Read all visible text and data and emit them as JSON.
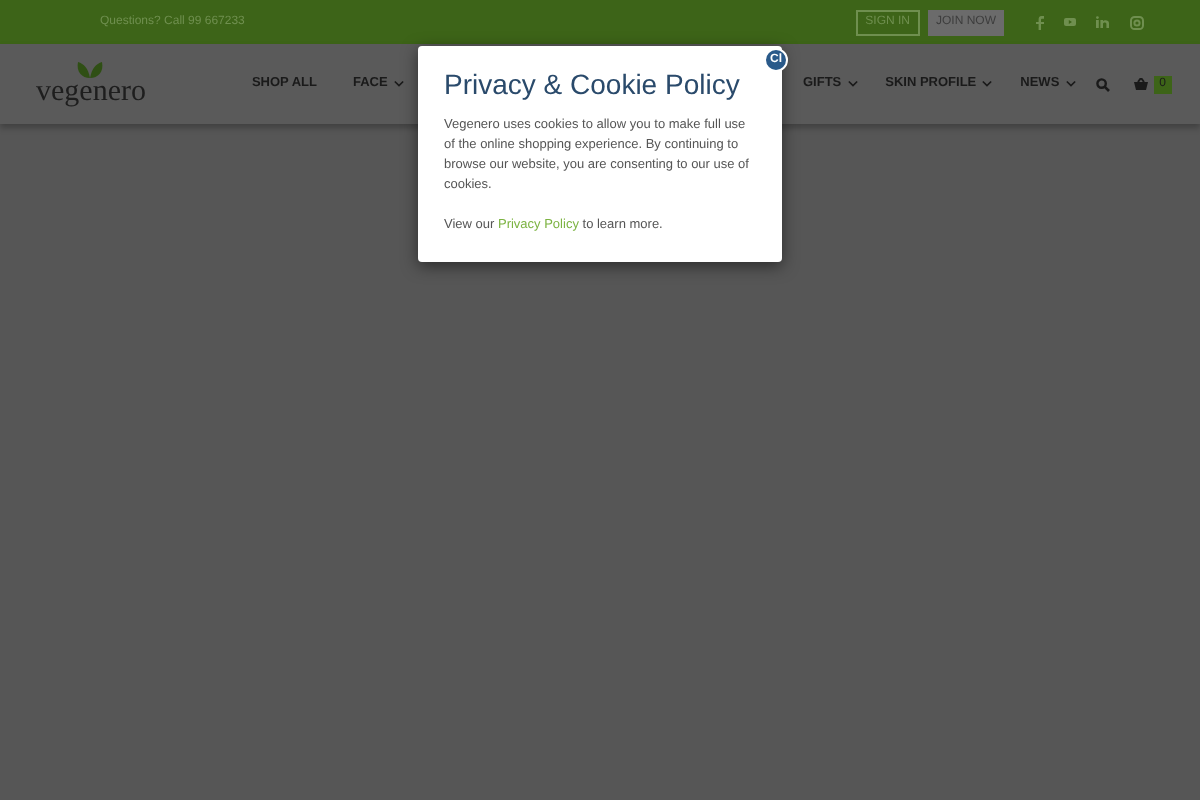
{
  "top_bar": {
    "phone_text": "Questions? Call 99 667233",
    "buttons": [
      {
        "label": "SIGN IN",
        "kind": "outline"
      },
      {
        "label": "JOIN NOW",
        "kind": "filled"
      }
    ]
  },
  "header": {
    "logo": "vegenero",
    "nav": [
      {
        "label": "SHOP ALL",
        "dropdown": false
      },
      {
        "label": "FACE",
        "dropdown": true
      },
      {
        "label": "GIFTS",
        "dropdown": true
      },
      {
        "label": "SKIN PROFILE",
        "dropdown": true
      },
      {
        "label": "NEWS",
        "dropdown": true
      }
    ],
    "cart_count": "0"
  },
  "modal": {
    "title": "Privacy & Cookie Policy",
    "close_label": "Cl",
    "body": "Vegenero uses cookies to allow you to make full use of the online shopping experience. By continuing to browse our website, you are consenting to our use of cookies.",
    "footer_before": "View our",
    "link": "Privacy Policy",
    "footer_after": "to learn more."
  }
}
